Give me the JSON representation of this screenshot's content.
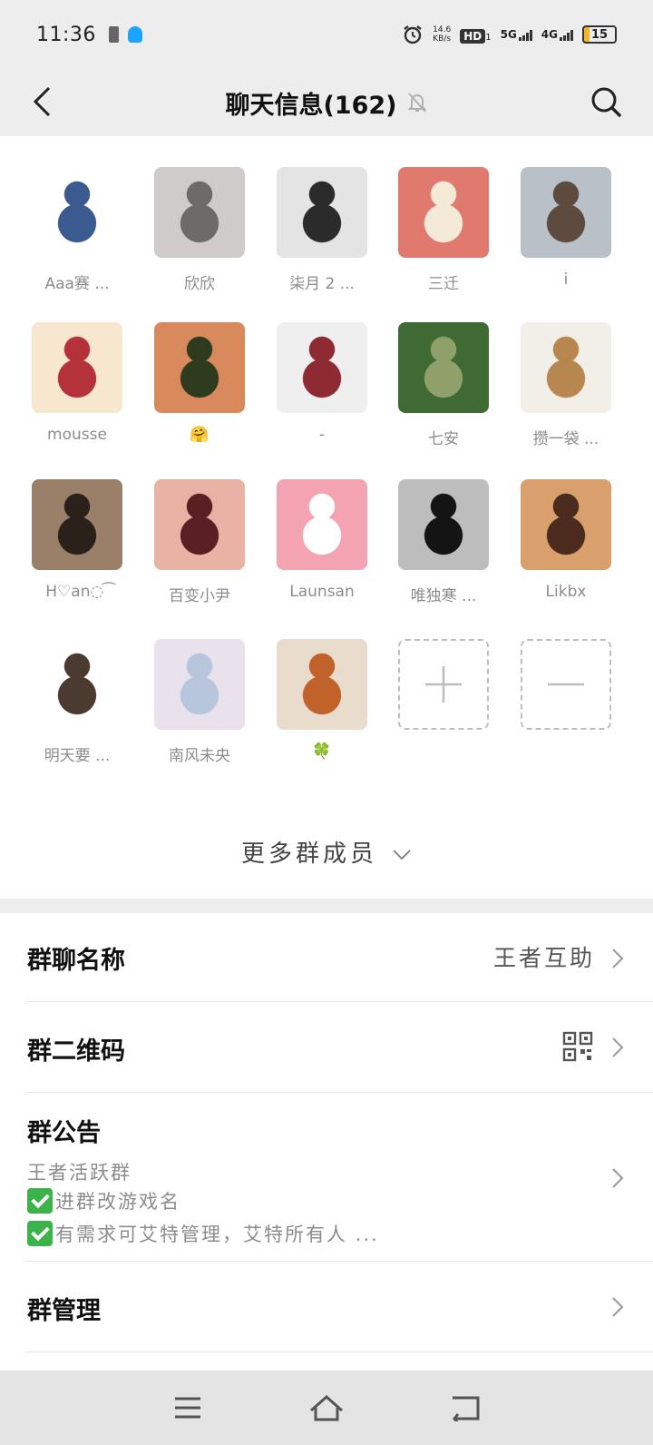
{
  "status_bar": {
    "time": "11:36",
    "net_speed_value": "14.6",
    "net_speed_unit": "KB/s",
    "hd_label": "HD",
    "hd_sub": "1",
    "net1": "5G",
    "net2": "4G",
    "battery": "15"
  },
  "header": {
    "title": "聊天信息(162)",
    "back_icon": "chevron-left-icon",
    "search_icon": "search-icon",
    "mute_icon": "bell-off-icon"
  },
  "members": [
    {
      "name": "Aaa赛 ...",
      "avatar_colors": [
        "#ffffff",
        "#3a5a90"
      ]
    },
    {
      "name": "欣欣",
      "avatar_colors": [
        "#cfcbcb",
        "#6f6a6a"
      ]
    },
    {
      "name": "柒月 2 ...",
      "avatar_colors": [
        "#e4e4e4",
        "#2b2b2b"
      ]
    },
    {
      "name": "三迁",
      "avatar_colors": [
        "#e07a6e",
        "#f5e9d8"
      ]
    },
    {
      "name": "i",
      "avatar_colors": [
        "#b9c0c7",
        "#5d4b40"
      ]
    },
    {
      "name": "mousse",
      "avatar_colors": [
        "#f7e7cf",
        "#b5323a"
      ]
    },
    {
      "name": "🤗",
      "avatar_colors": [
        "#d98a5c",
        "#2f3b1e"
      ]
    },
    {
      "name": "-",
      "avatar_colors": [
        "#efefef",
        "#8e2a32"
      ]
    },
    {
      "name": "七安",
      "avatar_colors": [
        "#3f6a34",
        "#8fa06b"
      ]
    },
    {
      "name": "攒一袋 ...",
      "avatar_colors": [
        "#f2eee8",
        "#b7874f"
      ]
    },
    {
      "name": "H♡an◌ ͡",
      "avatar_colors": [
        "#9a8069",
        "#2b211b"
      ]
    },
    {
      "name": "百变小尹",
      "avatar_colors": [
        "#e8b3a4",
        "#5a1f22"
      ]
    },
    {
      "name": "Launsan",
      "avatar_colors": [
        "#f4a3b3",
        "#ffffff"
      ]
    },
    {
      "name": "唯独寒 ...",
      "avatar_colors": [
        "#bdbdbd",
        "#141414"
      ]
    },
    {
      "name": "Likbx",
      "avatar_colors": [
        "#d99f6c",
        "#4a2b1e"
      ]
    },
    {
      "name": "明天要 ...",
      "avatar_colors": [
        "#ffffff",
        "#4a3a30"
      ]
    },
    {
      "name": "南风未央",
      "avatar_colors": [
        "#e9e2ec",
        "#b7c6dc"
      ]
    },
    {
      "name": "🍀",
      "avatar_colors": [
        "#e9dccd",
        "#c0622a"
      ]
    }
  ],
  "add_member_icon": "plus-icon",
  "remove_member_icon": "minus-icon",
  "more_members_label": "更多群成员",
  "settings": {
    "group_name_label": "群聊名称",
    "group_name_value": "王者互助",
    "qr_label": "群二维码",
    "qr_icon": "qr-code-icon",
    "notice_label": "群公告",
    "notice_lines": [
      "王者活跃群",
      "进群改游戏名",
      "有需求可艾特管理，艾特所有人 ..."
    ],
    "manage_label": "群管理"
  },
  "nav": {
    "menu_icon": "menu-icon",
    "home_icon": "home-icon",
    "back_icon": "back-icon"
  }
}
